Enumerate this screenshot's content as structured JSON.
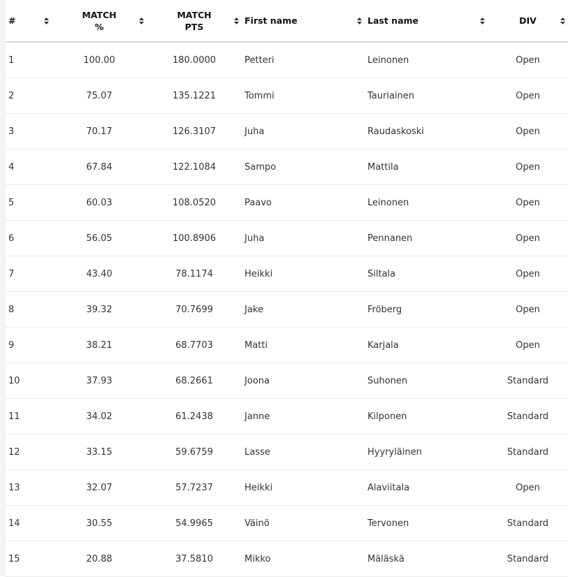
{
  "table": {
    "columns": [
      {
        "key": "rank",
        "label": "#"
      },
      {
        "key": "match_pct",
        "label_line1": "MATCH",
        "label_line2": "%"
      },
      {
        "key": "match_pts",
        "label_line1": "MATCH",
        "label_line2": "PTS"
      },
      {
        "key": "first_name",
        "label": "First name"
      },
      {
        "key": "last_name",
        "label": "Last name"
      },
      {
        "key": "div",
        "label": "DIV"
      }
    ],
    "rows": [
      {
        "rank": "1",
        "match_pct": "100.00",
        "match_pts": "180.0000",
        "first_name": "Petteri",
        "last_name": "Leinonen",
        "div": "Open"
      },
      {
        "rank": "2",
        "match_pct": "75.07",
        "match_pts": "135.1221",
        "first_name": "Tommi",
        "last_name": "Tauriainen",
        "div": "Open"
      },
      {
        "rank": "3",
        "match_pct": "70.17",
        "match_pts": "126.3107",
        "first_name": "Juha",
        "last_name": "Raudaskoski",
        "div": "Open"
      },
      {
        "rank": "4",
        "match_pct": "67.84",
        "match_pts": "122.1084",
        "first_name": "Sampo",
        "last_name": "Mattila",
        "div": "Open"
      },
      {
        "rank": "5",
        "match_pct": "60.03",
        "match_pts": "108.0520",
        "first_name": "Paavo",
        "last_name": "Leinonen",
        "div": "Open"
      },
      {
        "rank": "6",
        "match_pct": "56.05",
        "match_pts": "100.8906",
        "first_name": "Juha",
        "last_name": "Pennanen",
        "div": "Open"
      },
      {
        "rank": "7",
        "match_pct": "43.40",
        "match_pts": "78.1174",
        "first_name": "Heikki",
        "last_name": "Siltala",
        "div": "Open"
      },
      {
        "rank": "8",
        "match_pct": "39.32",
        "match_pts": "70.7699",
        "first_name": "Jake",
        "last_name": "Fröberg",
        "div": "Open"
      },
      {
        "rank": "9",
        "match_pct": "38.21",
        "match_pts": "68.7703",
        "first_name": "Matti",
        "last_name": "Karjala",
        "div": "Open"
      },
      {
        "rank": "10",
        "match_pct": "37.93",
        "match_pts": "68.2661",
        "first_name": "Joona",
        "last_name": "Suhonen",
        "div": "Standard"
      },
      {
        "rank": "11",
        "match_pct": "34.02",
        "match_pts": "61.2438",
        "first_name": "Janne",
        "last_name": "Kilponen",
        "div": "Standard"
      },
      {
        "rank": "12",
        "match_pct": "33.15",
        "match_pts": "59.6759",
        "first_name": "Lasse",
        "last_name": "Hyyryläinen",
        "div": "Standard"
      },
      {
        "rank": "13",
        "match_pct": "32.07",
        "match_pts": "57.7237",
        "first_name": "Heikki",
        "last_name": "Alaviitala",
        "div": "Open"
      },
      {
        "rank": "14",
        "match_pct": "30.55",
        "match_pts": "54.9965",
        "first_name": "Väinö",
        "last_name": "Tervonen",
        "div": "Standard"
      },
      {
        "rank": "15",
        "match_pct": "20.88",
        "match_pts": "37.5810",
        "first_name": "Mikko",
        "last_name": "Mäläskä",
        "div": "Standard"
      }
    ]
  },
  "icons": {
    "sort": "sort-icon"
  },
  "colors": {
    "header_rule": "#d6d8db",
    "row_rule": "#e9eaec",
    "sidebar_strip": "#f2f3f5"
  }
}
